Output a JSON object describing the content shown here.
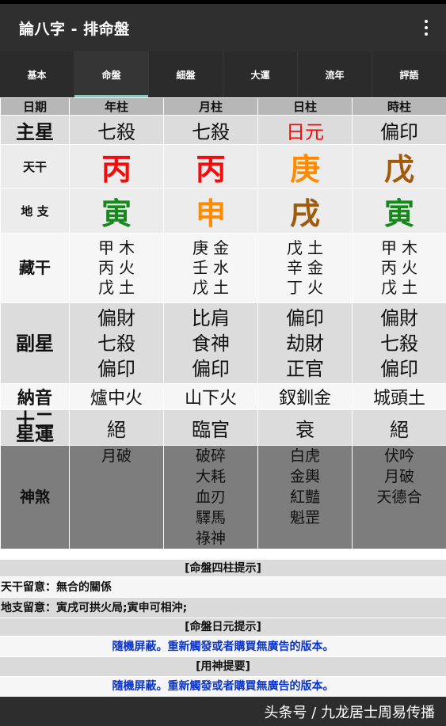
{
  "app": {
    "title": "論八字 - 排命盤"
  },
  "tabs": [
    {
      "label": "基本"
    },
    {
      "label": "命盤"
    },
    {
      "label": "細盤"
    },
    {
      "label": "大運"
    },
    {
      "label": "流年"
    },
    {
      "label": "評語"
    }
  ],
  "grid": {
    "headers": [
      "日期",
      "年柱",
      "月柱",
      "日柱",
      "時柱"
    ],
    "main_star": {
      "label": "主星",
      "values": [
        "七殺",
        "七殺",
        "日元",
        "偏印"
      ]
    },
    "heavenly_stem": {
      "label": "天干",
      "values": [
        "丙",
        "丙",
        "庚",
        "戊"
      ]
    },
    "earthly_branch": {
      "label": "地 支",
      "values": [
        "寅",
        "申",
        "戌",
        "寅"
      ]
    },
    "hidden_stems": {
      "label": "藏干",
      "pillars": [
        [
          [
            "甲",
            "木"
          ],
          [
            "丙",
            "火"
          ],
          [
            "戊",
            "土"
          ]
        ],
        [
          [
            "庚",
            "金"
          ],
          [
            "壬",
            "水"
          ],
          [
            "戊",
            "土"
          ]
        ],
        [
          [
            "戊",
            "土"
          ],
          [
            "辛",
            "金"
          ],
          [
            "丁",
            "火"
          ]
        ],
        [
          [
            "甲",
            "木"
          ],
          [
            "丙",
            "火"
          ],
          [
            "戊",
            "土"
          ]
        ]
      ]
    },
    "secondary_star": {
      "label": "副星",
      "pillars": [
        [
          "偏財",
          "七殺",
          "偏印"
        ],
        [
          "比肩",
          "食神",
          "偏印"
        ],
        [
          "偏印",
          "劫財",
          "正官"
        ],
        [
          "偏財",
          "七殺",
          "偏印"
        ]
      ]
    },
    "nayin": {
      "label": "納音",
      "values": [
        "爐中火",
        "山下火",
        "釵釧金",
        "城頭土"
      ]
    },
    "life_stage": {
      "label_line1": "十二",
      "label_line2": "星運",
      "values": [
        "絕",
        "臨官",
        "衰",
        "絕"
      ]
    },
    "spirits": {
      "label": "神煞",
      "pillars": [
        [
          "月破"
        ],
        [
          "破碎",
          "大耗",
          "血刃",
          "驛馬",
          "祿神"
        ],
        [
          "白虎",
          "金輿",
          "紅豔",
          "魁罡"
        ],
        [
          "伏吟",
          "月破",
          "天德合"
        ]
      ]
    }
  },
  "sections": {
    "four_pillars_title": "[命盤四柱提示]",
    "stem_note": "天干留意：無合的關係",
    "branch_note": "地支留意：寅戌可拱火局;寅申可相沖;",
    "day_master_title": "[命盤日元提示]",
    "ad_text_1": "隨機屏蔽。重新觸發或者購買無廣告的版本。",
    "useful_god_title": "[用神提要]",
    "ad_text_2": "隨機屏蔽。重新觸發或者購買無廣告的版本。"
  },
  "footer": {
    "watermark": "头条号 / 九龙居士周易传播"
  },
  "colors": {
    "red": "#f20c0c",
    "orange": "#ff8c00",
    "brown": "#a05a0a",
    "green": "#138a1a",
    "black": "#111111",
    "blue_link": "#0b34c9",
    "tab_indicator": "#8fc3ba"
  }
}
